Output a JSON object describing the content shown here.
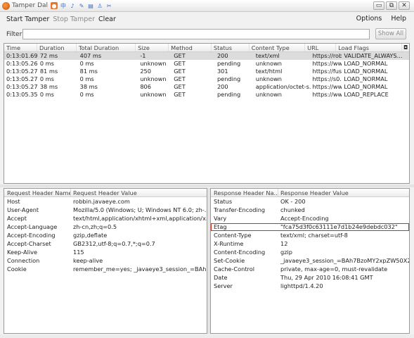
{
  "window": {
    "title": "Tamper Dal",
    "tray_icons": [
      "中",
      "♪",
      "✎",
      "▤",
      "♙",
      "✂"
    ],
    "controls": [
      "▭",
      "⧉",
      "✕"
    ]
  },
  "toolbar": {
    "start": "Start Tamper",
    "stop": "Stop Tamper",
    "clear": "Clear",
    "options": "Options",
    "help": "Help"
  },
  "filter": {
    "label": "Filter",
    "value": "",
    "show_all": "Show All"
  },
  "requests": {
    "columns": [
      "Time",
      "Duration",
      "Total Duration",
      "Size",
      "Method",
      "Status",
      "Content Type",
      "URL",
      "Load Flags"
    ],
    "rows": [
      [
        "0:13:01.691",
        "72 ms",
        "407 ms",
        "-1",
        "GET",
        "200",
        "text/xml",
        "https://rob...",
        "VALIDATE_ALWAYS..."
      ],
      [
        "0:13:05.261",
        "0 ms",
        "0 ms",
        "unknown",
        "GET",
        "pending",
        "unknown",
        "https://ww...",
        "LOAD_NORMAL"
      ],
      [
        "0:13:05.272",
        "81 ms",
        "81 ms",
        "250",
        "GET",
        "301",
        "text/html",
        "https://fusi...",
        "LOAD_NORMAL"
      ],
      [
        "0:13:05.275",
        "0 ms",
        "0 ms",
        "unknown",
        "GET",
        "pending",
        "unknown",
        "https://s0...",
        "LOAD_NORMAL"
      ],
      [
        "0:13:05.276",
        "38 ms",
        "38 ms",
        "806",
        "GET",
        "200",
        "application/octet-s...",
        "https://ww...",
        "LOAD_NORMAL"
      ],
      [
        "0:13:05.355",
        "0 ms",
        "0 ms",
        "unknown",
        "GET",
        "pending",
        "unknown",
        "https://ww...",
        "LOAD_REPLACE"
      ]
    ]
  },
  "request_headers": {
    "name_col": "Request Header Name",
    "value_col": "Request Header Value",
    "rows": [
      [
        "Host",
        "robbin.javaeye.com"
      ],
      [
        "User-Agent",
        "Mozilla/5.0 (Windows; U; Windows NT 6.0; zh-..."
      ],
      [
        "Accept",
        "text/html,application/xhtml+xml,application/x..."
      ],
      [
        "Accept-Language",
        "zh-cn,zh;q=0.5"
      ],
      [
        "Accept-Encoding",
        "gzip,deflate"
      ],
      [
        "Accept-Charset",
        "GB2312,utf-8;q=0.7,*;q=0.7"
      ],
      [
        "Keep-Alive",
        "115"
      ],
      [
        "Connection",
        "keep-alive"
      ],
      [
        "Cookie",
        "remember_me=yes; _javaeye3_session_=BAh7..."
      ]
    ]
  },
  "response_headers": {
    "name_col": "Response Header Na...",
    "value_col": "Response Header Value",
    "rows": [
      [
        "Status",
        "OK - 200"
      ],
      [
        "Transfer-Encoding",
        "chunked"
      ],
      [
        "Vary",
        "Accept-Encoding"
      ],
      [
        "Etag",
        "\"fca75d3f0c63111e7d1b24e9debdc032\""
      ],
      [
        "Content-Type",
        "text/xml; charset=utf-8"
      ],
      [
        "X-Runtime",
        "12"
      ],
      [
        "Content-Encoding",
        "gzip"
      ],
      [
        "Set-Cookie",
        "_javaeye3_session_=BAh7BzoMY2xpZW50X2lkIgZ0C..."
      ],
      [
        "Cache-Control",
        "private, max-age=0, must-revalidate"
      ],
      [
        "Date",
        "Thu, 29 Apr 2010 16:08:41 GMT"
      ],
      [
        "Server",
        "lighttpd/1.4.20"
      ]
    ],
    "highlighted_row": 3,
    "highlight_color": "#d62a1e"
  }
}
